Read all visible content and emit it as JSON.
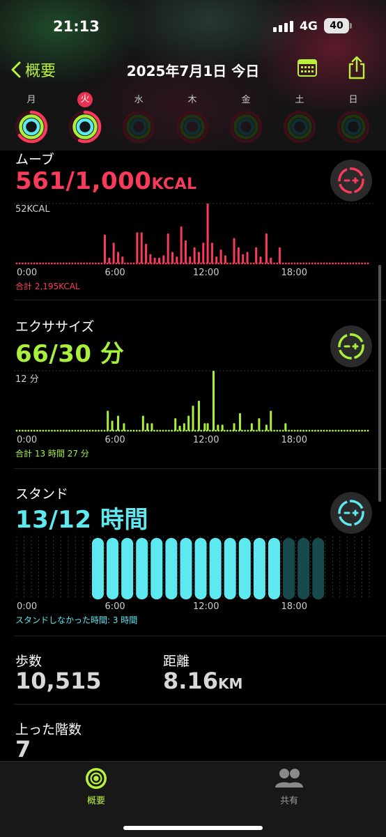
{
  "status": {
    "time": "21:13",
    "network": "4G",
    "battery": "40"
  },
  "nav": {
    "back_label": "概要",
    "title": "2025年7月1日 今日"
  },
  "week": [
    {
      "label": "月",
      "active": false,
      "move": 0.65,
      "exercise": 1.0,
      "stand": 1.0
    },
    {
      "label": "火",
      "active": true,
      "move": 0.56,
      "exercise": 1.0,
      "stand": 1.0
    },
    {
      "label": "水",
      "active": false,
      "move": 0,
      "exercise": 0,
      "stand": 0
    },
    {
      "label": "木",
      "active": false,
      "move": 0,
      "exercise": 0,
      "stand": 0
    },
    {
      "label": "金",
      "active": false,
      "move": 0,
      "exercise": 0,
      "stand": 0
    },
    {
      "label": "土",
      "active": false,
      "move": 0,
      "exercise": 0,
      "stand": 0
    },
    {
      "label": "日",
      "active": false,
      "move": 0,
      "exercise": 0,
      "stand": 0
    }
  ],
  "colors": {
    "move": "#fa3a5a",
    "exercise": "#a8f03a",
    "stand": "#5ee8f0",
    "accent": "#b8f23c"
  },
  "move": {
    "label": "ムーブ",
    "value": "561/1,000",
    "unit": "KCAL",
    "ymax_label": "52KCAL",
    "total": "合計 2,195KCAL"
  },
  "exercise": {
    "label": "エクササイズ",
    "value": "66/30",
    "unit": "分",
    "ymax_label": "12 分",
    "total": "合計 13 時間 27 分"
  },
  "stand": {
    "label": "スタンド",
    "value": "13/12",
    "unit": "時間",
    "total": "スタンドしなかった時間: 3 時間"
  },
  "x_ticks": [
    "0:00",
    "6:00",
    "12:00",
    "18:00"
  ],
  "steps": {
    "label": "歩数",
    "value": "10,515"
  },
  "distance": {
    "label": "距離",
    "value": "8.16",
    "unit": "KM"
  },
  "floors": {
    "label": "上った階数",
    "value": "7"
  },
  "tabs": {
    "summary": "概要",
    "sharing": "共有"
  },
  "chart_data": [
    {
      "type": "bar",
      "title": "ムーブ",
      "ylabel": "KCAL",
      "ylim": [
        0,
        52
      ],
      "x": [
        "0:00",
        "6:00",
        "12:00",
        "18:00"
      ],
      "values": [
        0,
        0,
        0,
        0,
        0,
        0,
        0,
        0,
        0,
        0,
        0,
        0,
        0,
        0,
        0,
        0,
        0,
        0,
        0,
        0,
        0,
        0,
        0,
        0,
        0,
        0,
        0,
        0,
        0,
        0,
        0,
        0,
        0,
        0,
        0,
        0,
        0,
        0,
        0,
        0,
        0,
        0,
        0,
        0,
        0,
        0,
        0,
        0,
        0,
        0,
        0,
        0,
        0,
        0,
        0,
        0,
        0,
        0,
        0,
        0,
        0,
        0,
        0,
        0,
        0,
        0,
        0,
        0,
        0,
        0,
        0,
        0,
        0,
        0,
        0,
        0,
        0,
        0,
        0,
        0,
        0,
        0,
        0,
        0,
        0,
        0,
        0,
        0,
        0,
        0,
        0,
        0,
        0,
        0,
        0,
        0,
        0,
        0,
        0,
        0,
        0,
        0,
        0,
        0,
        0,
        0,
        0,
        0,
        0,
        0,
        0,
        0,
        0,
        0,
        0,
        0,
        0,
        0,
        0,
        0,
        0,
        0,
        0,
        0,
        0,
        0,
        0,
        0,
        0,
        0,
        0,
        0,
        0,
        0,
        0,
        0,
        0,
        0,
        0,
        0,
        0,
        0,
        0,
        0,
        0,
        0,
        0,
        0,
        0,
        0,
        0,
        0,
        0,
        0,
        0,
        0,
        0,
        0,
        0,
        0,
        0,
        0,
        0,
        0,
        0,
        0,
        0,
        0,
        0,
        0,
        0,
        0,
        0,
        0,
        0,
        0,
        0,
        0,
        0,
        0,
        0,
        0,
        0,
        0,
        0,
        0,
        0,
        0,
        0,
        0,
        0,
        0,
        0,
        0,
        0,
        0,
        0,
        0,
        0,
        0,
        0,
        0,
        0,
        0,
        0,
        0,
        0,
        0,
        0,
        0,
        0,
        0,
        0,
        0,
        0,
        0,
        0,
        0,
        0,
        0,
        0,
        0,
        0,
        0,
        0,
        0,
        0,
        0,
        0,
        0,
        0,
        0,
        0,
        0,
        0,
        0,
        0,
        0,
        0,
        0,
        0,
        0,
        0,
        0,
        0,
        0,
        0,
        0,
        0,
        0,
        0,
        0,
        0,
        0,
        0,
        0,
        0,
        0,
        0,
        0,
        0,
        0,
        0,
        0,
        0,
        0,
        0,
        0,
        0,
        0,
        0,
        0,
        0,
        0,
        0,
        0,
        0,
        0,
        0,
        0,
        0,
        0,
        0,
        0,
        0,
        0,
        0,
        0,
        0,
        0,
        0,
        0,
        0,
        0,
        0,
        0,
        0,
        0,
        0,
        0,
        0,
        0,
        0,
        0,
        0,
        0,
        0,
        0,
        0,
        0,
        0,
        0,
        0,
        0,
        0,
        0
      ],
      "bars": [
        {
          "h": 6.0,
          "v": 25
        },
        {
          "h": 6.3,
          "v": 5
        },
        {
          "h": 6.6,
          "v": 18
        },
        {
          "h": 6.9,
          "v": 10
        },
        {
          "h": 7.2,
          "v": 6
        },
        {
          "h": 8.2,
          "v": 27
        },
        {
          "h": 8.5,
          "v": 27
        },
        {
          "h": 8.8,
          "v": 17
        },
        {
          "h": 9.1,
          "v": 8
        },
        {
          "h": 9.4,
          "v": 5
        },
        {
          "h": 9.7,
          "v": 5
        },
        {
          "h": 10.0,
          "v": 7
        },
        {
          "h": 10.3,
          "v": 26
        },
        {
          "h": 10.6,
          "v": 10
        },
        {
          "h": 10.9,
          "v": 6
        },
        {
          "h": 11.2,
          "v": 32
        },
        {
          "h": 11.5,
          "v": 20
        },
        {
          "h": 11.8,
          "v": 6
        },
        {
          "h": 12.1,
          "v": 14
        },
        {
          "h": 12.4,
          "v": 10
        },
        {
          "h": 12.7,
          "v": 18
        },
        {
          "h": 13.0,
          "v": 52
        },
        {
          "h": 13.3,
          "v": 18
        },
        {
          "h": 13.6,
          "v": 6
        },
        {
          "h": 13.9,
          "v": 12
        },
        {
          "h": 14.2,
          "v": 7
        },
        {
          "h": 14.8,
          "v": 22
        },
        {
          "h": 15.1,
          "v": 14
        },
        {
          "h": 15.4,
          "v": 8
        },
        {
          "h": 15.7,
          "v": 10
        },
        {
          "h": 16.3,
          "v": 14
        },
        {
          "h": 16.6,
          "v": 6
        },
        {
          "h": 17.0,
          "v": 26
        },
        {
          "h": 17.3,
          "v": 5
        },
        {
          "h": 17.9,
          "v": 14
        }
      ]
    },
    {
      "type": "bar",
      "title": "エクササイズ",
      "ylabel": "分",
      "ylim": [
        0,
        12
      ],
      "x": [
        "0:00",
        "6:00",
        "12:00",
        "18:00"
      ],
      "bars": [
        {
          "h": 6.2,
          "v": 4
        },
        {
          "h": 6.5,
          "v": 2
        },
        {
          "h": 6.9,
          "v": 3
        },
        {
          "h": 7.3,
          "v": 1.5
        },
        {
          "h": 8.6,
          "v": 3
        },
        {
          "h": 8.9,
          "v": 1.5
        },
        {
          "h": 9.2,
          "v": 1.5
        },
        {
          "h": 10.8,
          "v": 2.5
        },
        {
          "h": 11.1,
          "v": 1
        },
        {
          "h": 11.4,
          "v": 1.5
        },
        {
          "h": 11.7,
          "v": 3
        },
        {
          "h": 12.0,
          "v": 5
        },
        {
          "h": 12.4,
          "v": 6
        },
        {
          "h": 12.8,
          "v": 1.5
        },
        {
          "h": 13.0,
          "v": 1.5
        },
        {
          "h": 13.4,
          "v": 12
        },
        {
          "h": 13.7,
          "v": 1.2
        },
        {
          "h": 14.0,
          "v": 1.2
        },
        {
          "h": 14.8,
          "v": 1.5
        },
        {
          "h": 15.2,
          "v": 3.5
        },
        {
          "h": 16.0,
          "v": 1.5
        },
        {
          "h": 16.5,
          "v": 2.5
        },
        {
          "h": 17.0,
          "v": 1.2
        },
        {
          "h": 17.3,
          "v": 4
        },
        {
          "h": 18.3,
          "v": 1.5
        }
      ]
    },
    {
      "type": "bar",
      "title": "スタンド",
      "ylabel": "時間",
      "x": [
        "0:00",
        "6:00",
        "12:00",
        "18:00"
      ],
      "hours": [
        {
          "h": 5,
          "stood": true
        },
        {
          "h": 6,
          "stood": true
        },
        {
          "h": 7,
          "stood": true
        },
        {
          "h": 8,
          "stood": true
        },
        {
          "h": 9,
          "stood": true
        },
        {
          "h": 10,
          "stood": true
        },
        {
          "h": 11,
          "stood": true
        },
        {
          "h": 12,
          "stood": true
        },
        {
          "h": 13,
          "stood": true
        },
        {
          "h": 14,
          "stood": true
        },
        {
          "h": 15,
          "stood": true
        },
        {
          "h": 16,
          "stood": true
        },
        {
          "h": 17,
          "stood": true
        },
        {
          "h": 18,
          "stood": false
        },
        {
          "h": 19,
          "stood": false
        },
        {
          "h": 20,
          "stood": false
        }
      ]
    }
  ]
}
